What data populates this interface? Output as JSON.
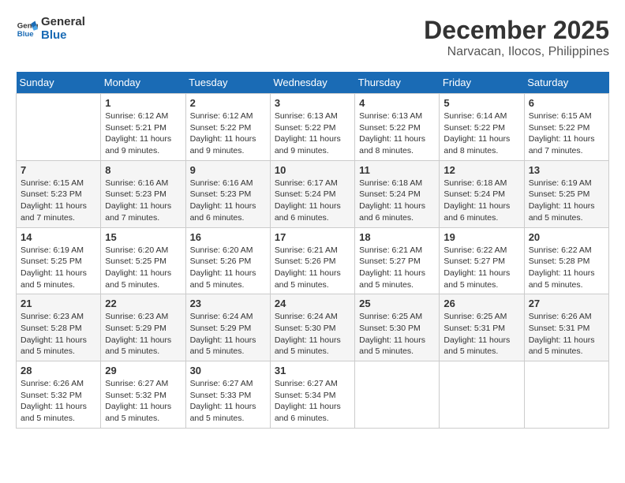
{
  "header": {
    "logo_line1": "General",
    "logo_line2": "Blue",
    "month": "December 2025",
    "location": "Narvacan, Ilocos, Philippines"
  },
  "weekdays": [
    "Sunday",
    "Monday",
    "Tuesday",
    "Wednesday",
    "Thursday",
    "Friday",
    "Saturday"
  ],
  "weeks": [
    [
      {
        "day": "",
        "info": ""
      },
      {
        "day": "1",
        "info": "Sunrise: 6:12 AM\nSunset: 5:21 PM\nDaylight: 11 hours\nand 9 minutes."
      },
      {
        "day": "2",
        "info": "Sunrise: 6:12 AM\nSunset: 5:22 PM\nDaylight: 11 hours\nand 9 minutes."
      },
      {
        "day": "3",
        "info": "Sunrise: 6:13 AM\nSunset: 5:22 PM\nDaylight: 11 hours\nand 9 minutes."
      },
      {
        "day": "4",
        "info": "Sunrise: 6:13 AM\nSunset: 5:22 PM\nDaylight: 11 hours\nand 8 minutes."
      },
      {
        "day": "5",
        "info": "Sunrise: 6:14 AM\nSunset: 5:22 PM\nDaylight: 11 hours\nand 8 minutes."
      },
      {
        "day": "6",
        "info": "Sunrise: 6:15 AM\nSunset: 5:22 PM\nDaylight: 11 hours\nand 7 minutes."
      }
    ],
    [
      {
        "day": "7",
        "info": "Sunrise: 6:15 AM\nSunset: 5:23 PM\nDaylight: 11 hours\nand 7 minutes."
      },
      {
        "day": "8",
        "info": "Sunrise: 6:16 AM\nSunset: 5:23 PM\nDaylight: 11 hours\nand 7 minutes."
      },
      {
        "day": "9",
        "info": "Sunrise: 6:16 AM\nSunset: 5:23 PM\nDaylight: 11 hours\nand 6 minutes."
      },
      {
        "day": "10",
        "info": "Sunrise: 6:17 AM\nSunset: 5:24 PM\nDaylight: 11 hours\nand 6 minutes."
      },
      {
        "day": "11",
        "info": "Sunrise: 6:18 AM\nSunset: 5:24 PM\nDaylight: 11 hours\nand 6 minutes."
      },
      {
        "day": "12",
        "info": "Sunrise: 6:18 AM\nSunset: 5:24 PM\nDaylight: 11 hours\nand 6 minutes."
      },
      {
        "day": "13",
        "info": "Sunrise: 6:19 AM\nSunset: 5:25 PM\nDaylight: 11 hours\nand 5 minutes."
      }
    ],
    [
      {
        "day": "14",
        "info": "Sunrise: 6:19 AM\nSunset: 5:25 PM\nDaylight: 11 hours\nand 5 minutes."
      },
      {
        "day": "15",
        "info": "Sunrise: 6:20 AM\nSunset: 5:25 PM\nDaylight: 11 hours\nand 5 minutes."
      },
      {
        "day": "16",
        "info": "Sunrise: 6:20 AM\nSunset: 5:26 PM\nDaylight: 11 hours\nand 5 minutes."
      },
      {
        "day": "17",
        "info": "Sunrise: 6:21 AM\nSunset: 5:26 PM\nDaylight: 11 hours\nand 5 minutes."
      },
      {
        "day": "18",
        "info": "Sunrise: 6:21 AM\nSunset: 5:27 PM\nDaylight: 11 hours\nand 5 minutes."
      },
      {
        "day": "19",
        "info": "Sunrise: 6:22 AM\nSunset: 5:27 PM\nDaylight: 11 hours\nand 5 minutes."
      },
      {
        "day": "20",
        "info": "Sunrise: 6:22 AM\nSunset: 5:28 PM\nDaylight: 11 hours\nand 5 minutes."
      }
    ],
    [
      {
        "day": "21",
        "info": "Sunrise: 6:23 AM\nSunset: 5:28 PM\nDaylight: 11 hours\nand 5 minutes."
      },
      {
        "day": "22",
        "info": "Sunrise: 6:23 AM\nSunset: 5:29 PM\nDaylight: 11 hours\nand 5 minutes."
      },
      {
        "day": "23",
        "info": "Sunrise: 6:24 AM\nSunset: 5:29 PM\nDaylight: 11 hours\nand 5 minutes."
      },
      {
        "day": "24",
        "info": "Sunrise: 6:24 AM\nSunset: 5:30 PM\nDaylight: 11 hours\nand 5 minutes."
      },
      {
        "day": "25",
        "info": "Sunrise: 6:25 AM\nSunset: 5:30 PM\nDaylight: 11 hours\nand 5 minutes."
      },
      {
        "day": "26",
        "info": "Sunrise: 6:25 AM\nSunset: 5:31 PM\nDaylight: 11 hours\nand 5 minutes."
      },
      {
        "day": "27",
        "info": "Sunrise: 6:26 AM\nSunset: 5:31 PM\nDaylight: 11 hours\nand 5 minutes."
      }
    ],
    [
      {
        "day": "28",
        "info": "Sunrise: 6:26 AM\nSunset: 5:32 PM\nDaylight: 11 hours\nand 5 minutes."
      },
      {
        "day": "29",
        "info": "Sunrise: 6:27 AM\nSunset: 5:32 PM\nDaylight: 11 hours\nand 5 minutes."
      },
      {
        "day": "30",
        "info": "Sunrise: 6:27 AM\nSunset: 5:33 PM\nDaylight: 11 hours\nand 5 minutes."
      },
      {
        "day": "31",
        "info": "Sunrise: 6:27 AM\nSunset: 5:34 PM\nDaylight: 11 hours\nand 6 minutes."
      },
      {
        "day": "",
        "info": ""
      },
      {
        "day": "",
        "info": ""
      },
      {
        "day": "",
        "info": ""
      }
    ]
  ]
}
